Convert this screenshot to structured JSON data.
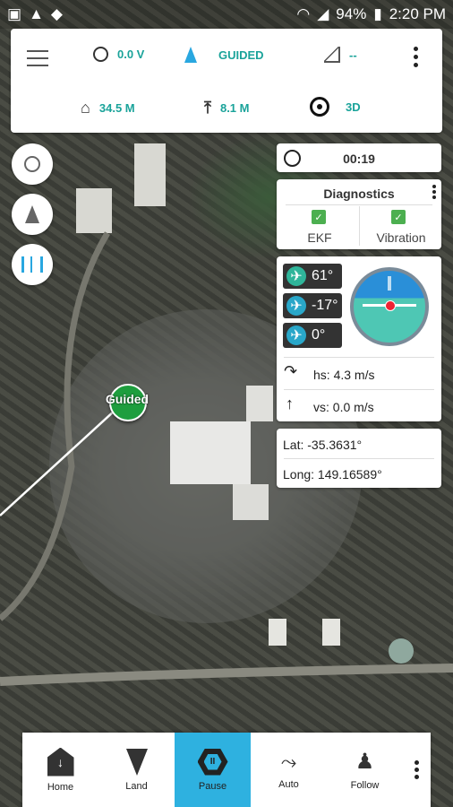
{
  "status_bar": {
    "battery": "94%",
    "time": "2:20 PM"
  },
  "top_bar": {
    "voltage": "0.0 V",
    "mode": "GUIDED",
    "signal": "--",
    "home_distance": "34.5 M",
    "altitude": "8.1 M",
    "gps_fix": "3D"
  },
  "timer": "00:19",
  "diagnostics": {
    "title": "Diagnostics",
    "ekf_label": "EKF",
    "vibration_label": "Vibration"
  },
  "attitude": {
    "yaw": "61°",
    "pitch": "-17°",
    "roll": "0°"
  },
  "speed": {
    "horizontal": "hs: 4.3 m/s",
    "vertical": "vs: 0.0 m/s"
  },
  "location": {
    "lat": "Lat: -35.3631°",
    "long": "Long: 149.16589°"
  },
  "map_marker": "Guided",
  "bottom_bar": [
    {
      "label": "Home"
    },
    {
      "label": "Land"
    },
    {
      "label": "Pause"
    },
    {
      "label": "Auto"
    },
    {
      "label": "Follow"
    }
  ],
  "colors": {
    "accent": "#1aa39a",
    "active_button": "#2eb1e0",
    "check": "#4caf50"
  }
}
